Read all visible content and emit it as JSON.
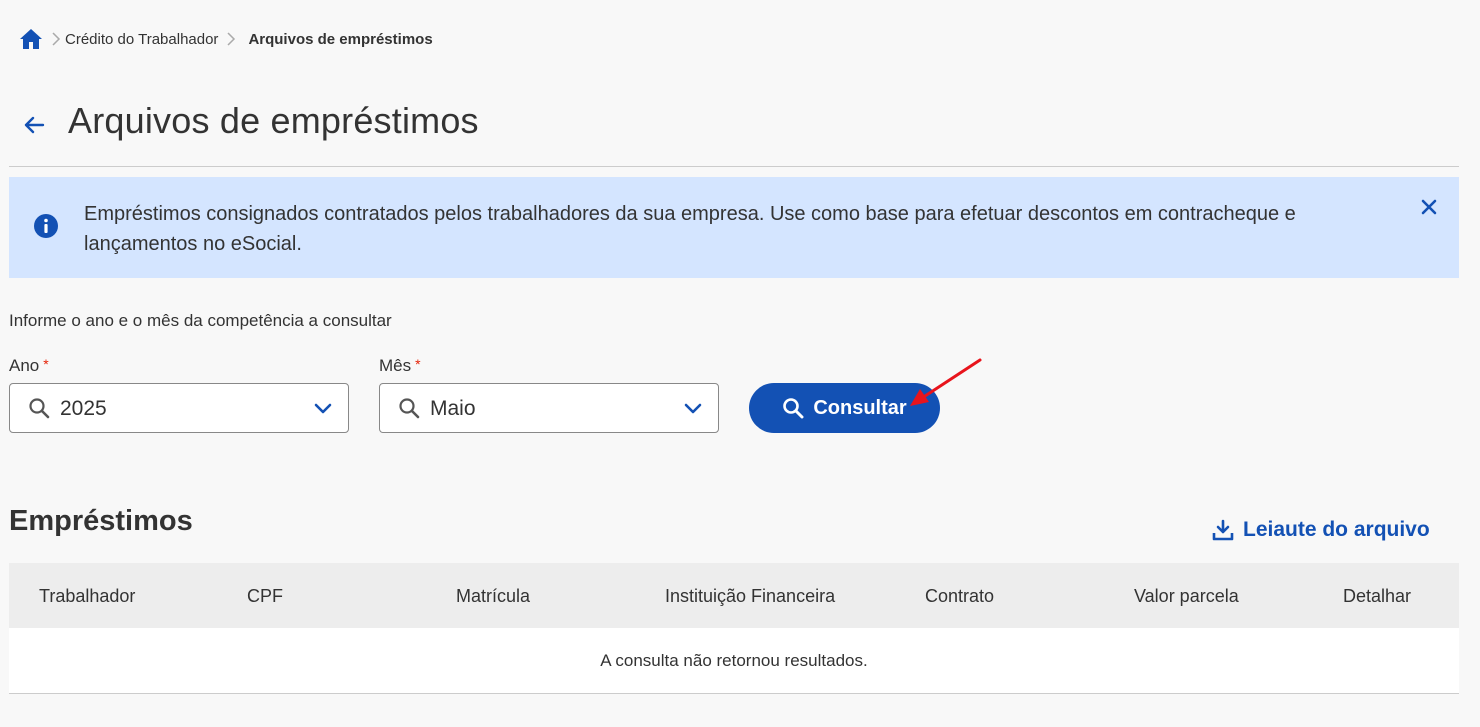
{
  "breadcrumb": {
    "home_icon": "home-icon",
    "items": [
      "Crédito do Trabalhador"
    ],
    "current": "Arquivos de empréstimos"
  },
  "header": {
    "title": "Arquivos de empréstimos",
    "back_icon": "arrow-left-icon"
  },
  "alert": {
    "icon": "info-icon",
    "text": "Empréstimos consignados contratados pelos trabalhadores da sua empresa. Use como base para efetuar descontos em contracheque e lançamentos no eSocial.",
    "close_icon": "close-icon"
  },
  "form": {
    "instruction": "Informe o ano e o mês da competência a consultar",
    "year": {
      "label": "Ano",
      "required_mark": "*",
      "value": "2025"
    },
    "month": {
      "label": "Mês",
      "required_mark": "*",
      "value": "Maio"
    },
    "submit_label": "Consultar"
  },
  "section": {
    "title": "Empréstimos",
    "layout_link": "Leiaute do arquivo",
    "layout_icon": "download-icon"
  },
  "table": {
    "columns": [
      "Trabalhador",
      "CPF",
      "Matrícula",
      "Instituição Financeira",
      "Contrato",
      "Valor parcela",
      "Detalhar"
    ],
    "empty_message": "A consulta não retornou resultados."
  },
  "colors": {
    "primary": "#1351b4",
    "alert_bg": "#d4e5ff",
    "required": "#e52207",
    "annotation": "#e8141c"
  }
}
